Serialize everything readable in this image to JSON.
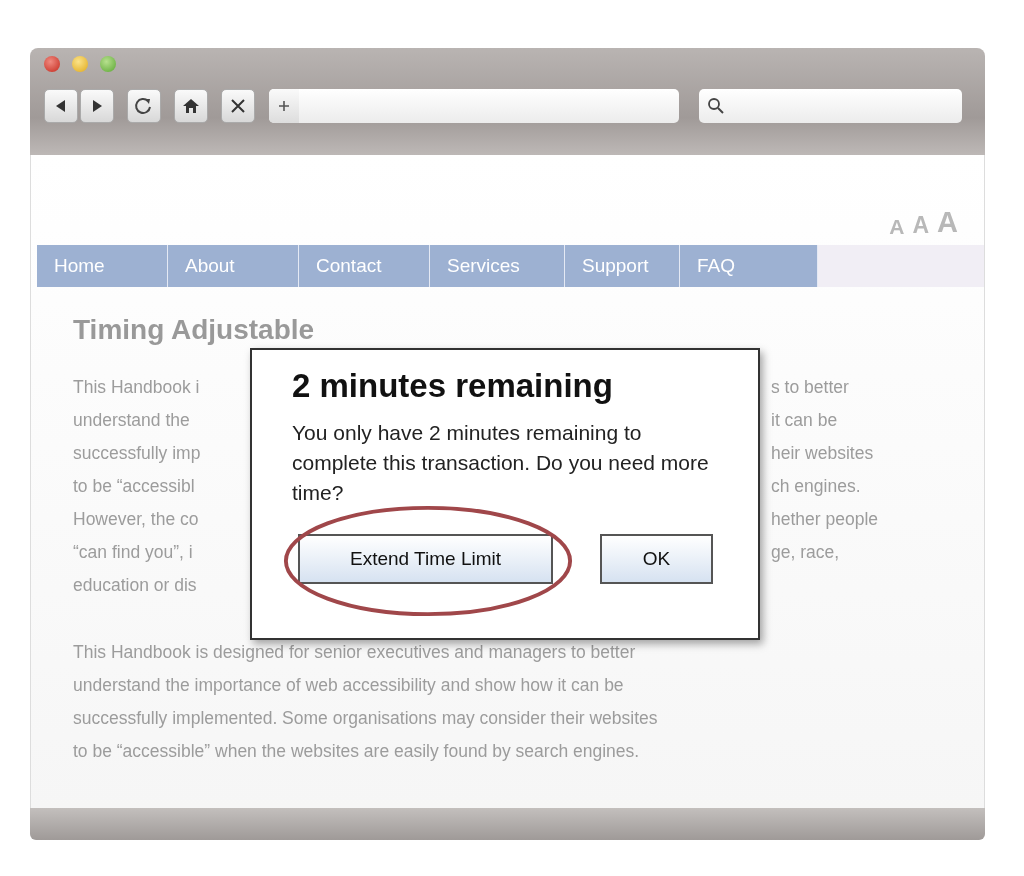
{
  "font_size_controls": [
    "A",
    "A",
    "A"
  ],
  "nav": {
    "items": [
      {
        "label": "Home"
      },
      {
        "label": "About"
      },
      {
        "label": "Contact"
      },
      {
        "label": "Services"
      },
      {
        "label": "Support"
      },
      {
        "label": "FAQ"
      }
    ]
  },
  "article": {
    "heading": "Timing Adjustable",
    "paragraph_1_left": [
      "This Handbook i",
      "understand the",
      "successfully imp",
      "to be “accessibl",
      "However, the co",
      "“can find you”, i",
      "education or dis"
    ],
    "paragraph_1_right": [
      "s to better",
      "it can be",
      "heir websites",
      "ch engines.",
      "hether people",
      "ge, race,"
    ],
    "paragraph_2": [
      "This Handbook is designed for senior executives and managers to better",
      "understand the importance of web accessibility and show how it can be",
      "successfully implemented. Some organisations may consider their websites",
      "to be “accessible” when the websites are easily found by search engines."
    ]
  },
  "dialog": {
    "title": "2 minutes remaining",
    "message": "You only have 2 minutes remaining to complete this transaction. Do you need more time?",
    "buttons": [
      {
        "label": "Extend Time Limit",
        "highlighted": true
      },
      {
        "label": "OK",
        "highlighted": false
      }
    ]
  }
}
